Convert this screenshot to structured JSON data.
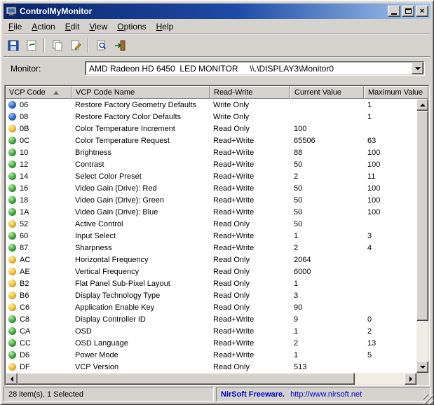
{
  "window": {
    "title": "ControlMyMonitor"
  },
  "menu": {
    "items": [
      "File",
      "Action",
      "Edit",
      "View",
      "Options",
      "Help"
    ]
  },
  "toolbar": {
    "buttons": [
      "save",
      "refresh",
      "copy",
      "properties",
      "find",
      "exit"
    ]
  },
  "monitor": {
    "label": "Monitor:",
    "value": "AMD Radeon HD 6450  LED MONITOR     \\\\.\\DISPLAY3\\Monitor0"
  },
  "table": {
    "columns": [
      "VCP Code",
      "VCP Code Name",
      "Read-Write",
      "Current Value",
      "Maximum Value"
    ],
    "rows": [
      {
        "icon": "blue",
        "code": "06",
        "name": "Restore Factory Geometry Defaults",
        "rw": "Write Only",
        "current": "",
        "max": "1"
      },
      {
        "icon": "blue",
        "code": "08",
        "name": "Restore Factory Color Defaults",
        "rw": "Write Only",
        "current": "",
        "max": "1"
      },
      {
        "icon": "yellow",
        "code": "0B",
        "name": "Color Temperature Increment",
        "rw": "Read Only",
        "current": "100",
        "max": ""
      },
      {
        "icon": "green",
        "code": "0C",
        "name": "Color Temperature Request",
        "rw": "Read+Write",
        "current": "65506",
        "max": "63"
      },
      {
        "icon": "green",
        "code": "10",
        "name": "Brightness",
        "rw": "Read+Write",
        "current": "88",
        "max": "100"
      },
      {
        "icon": "green",
        "code": "12",
        "name": "Contrast",
        "rw": "Read+Write",
        "current": "50",
        "max": "100"
      },
      {
        "icon": "green",
        "code": "14",
        "name": "Select Color Preset",
        "rw": "Read+Write",
        "current": "2",
        "max": "11"
      },
      {
        "icon": "green",
        "code": "16",
        "name": "Video Gain (Drive): Red",
        "rw": "Read+Write",
        "current": "50",
        "max": "100"
      },
      {
        "icon": "green",
        "code": "18",
        "name": "Video Gain (Drive): Green",
        "rw": "Read+Write",
        "current": "50",
        "max": "100"
      },
      {
        "icon": "green",
        "code": "1A",
        "name": "Video Gain (Drive): Blue",
        "rw": "Read+Write",
        "current": "50",
        "max": "100"
      },
      {
        "icon": "yellow",
        "code": "52",
        "name": "Active Control",
        "rw": "Read Only",
        "current": "50",
        "max": ""
      },
      {
        "icon": "green",
        "code": "60",
        "name": "Input Select",
        "rw": "Read+Write",
        "current": "1",
        "max": "3"
      },
      {
        "icon": "green",
        "code": "87",
        "name": "Sharpness",
        "rw": "Read+Write",
        "current": "2",
        "max": "4"
      },
      {
        "icon": "yellow",
        "code": "AC",
        "name": "Horizontal Frequency",
        "rw": "Read Only",
        "current": "2064",
        "max": ""
      },
      {
        "icon": "yellow",
        "code": "AE",
        "name": "Vertical Frequency",
        "rw": "Read Only",
        "current": "6000",
        "max": ""
      },
      {
        "icon": "yellow",
        "code": "B2",
        "name": "Flat Panel Sub-Pixel Layout",
        "rw": "Read Only",
        "current": "1",
        "max": ""
      },
      {
        "icon": "yellow",
        "code": "B6",
        "name": "Display Technology Type",
        "rw": "Read Only",
        "current": "3",
        "max": ""
      },
      {
        "icon": "yellow",
        "code": "C6",
        "name": "Application Enable Key",
        "rw": "Read Only",
        "current": "90",
        "max": ""
      },
      {
        "icon": "green",
        "code": "C8",
        "name": "Display Controller ID",
        "rw": "Read+Write",
        "current": "9",
        "max": "0"
      },
      {
        "icon": "green",
        "code": "CA",
        "name": "OSD",
        "rw": "Read+Write",
        "current": "1",
        "max": "2"
      },
      {
        "icon": "green",
        "code": "CC",
        "name": "OSD Language",
        "rw": "Read+Write",
        "current": "2",
        "max": "13"
      },
      {
        "icon": "green",
        "code": "D6",
        "name": "Power Mode",
        "rw": "Read+Write",
        "current": "1",
        "max": "5"
      },
      {
        "icon": "yellow",
        "code": "DF",
        "name": "VCP Version",
        "rw": "Read Only",
        "current": "513",
        "max": ""
      }
    ]
  },
  "statusbar": {
    "left": "28 item(s), 1 Selected",
    "brand": "NirSoft Freeware.",
    "url": "http://www.nirsoft.net"
  },
  "colors": {
    "titlebar_start": "#0A246A",
    "titlebar_end": "#A6CAF0",
    "window_bg": "#D6D3CE",
    "link": "#0000CC",
    "ball_blue": "#2A62C4",
    "ball_green": "#3AA43A",
    "ball_yellow": "#ECB92C"
  }
}
